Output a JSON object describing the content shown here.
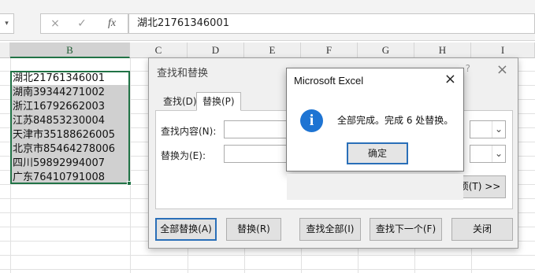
{
  "formula_bar": {
    "cancel_icon": "×",
    "confirm_icon": "✓",
    "fx_label": "fx",
    "formula_value": "湖北21761346001"
  },
  "sheet": {
    "columns": [
      "B",
      "C",
      "D",
      "E",
      "F",
      "G",
      "H",
      "I"
    ],
    "selected_column": "B",
    "cells": [
      "湖北21761346001",
      "湖南39344271002",
      "浙江16792662003",
      "江苏84853230004",
      "天津市35188626005",
      "北京市85464278006",
      "四川59892994007",
      "广东76410791008"
    ]
  },
  "find_replace": {
    "title": "查找和替换",
    "help": "?",
    "tabs": [
      {
        "label": "查找(D)"
      },
      {
        "label": "替换(P)"
      }
    ],
    "find_label": "查找内容(N):",
    "replace_label": "替换为(E):",
    "options_button": "选项(T) >>",
    "buttons": {
      "replace_all": "全部替换(A)",
      "replace": "替换(R)",
      "find_all": "查找全部(I)",
      "find_next": "查找下一个(F)",
      "close": "关闭"
    }
  },
  "message_box": {
    "title": "Microsoft Excel",
    "message": "全部完成。完成 6 处替换。",
    "ok": "确定"
  },
  "colors": {
    "excel_green": "#217346",
    "accent_blue": "#1e74d3"
  }
}
